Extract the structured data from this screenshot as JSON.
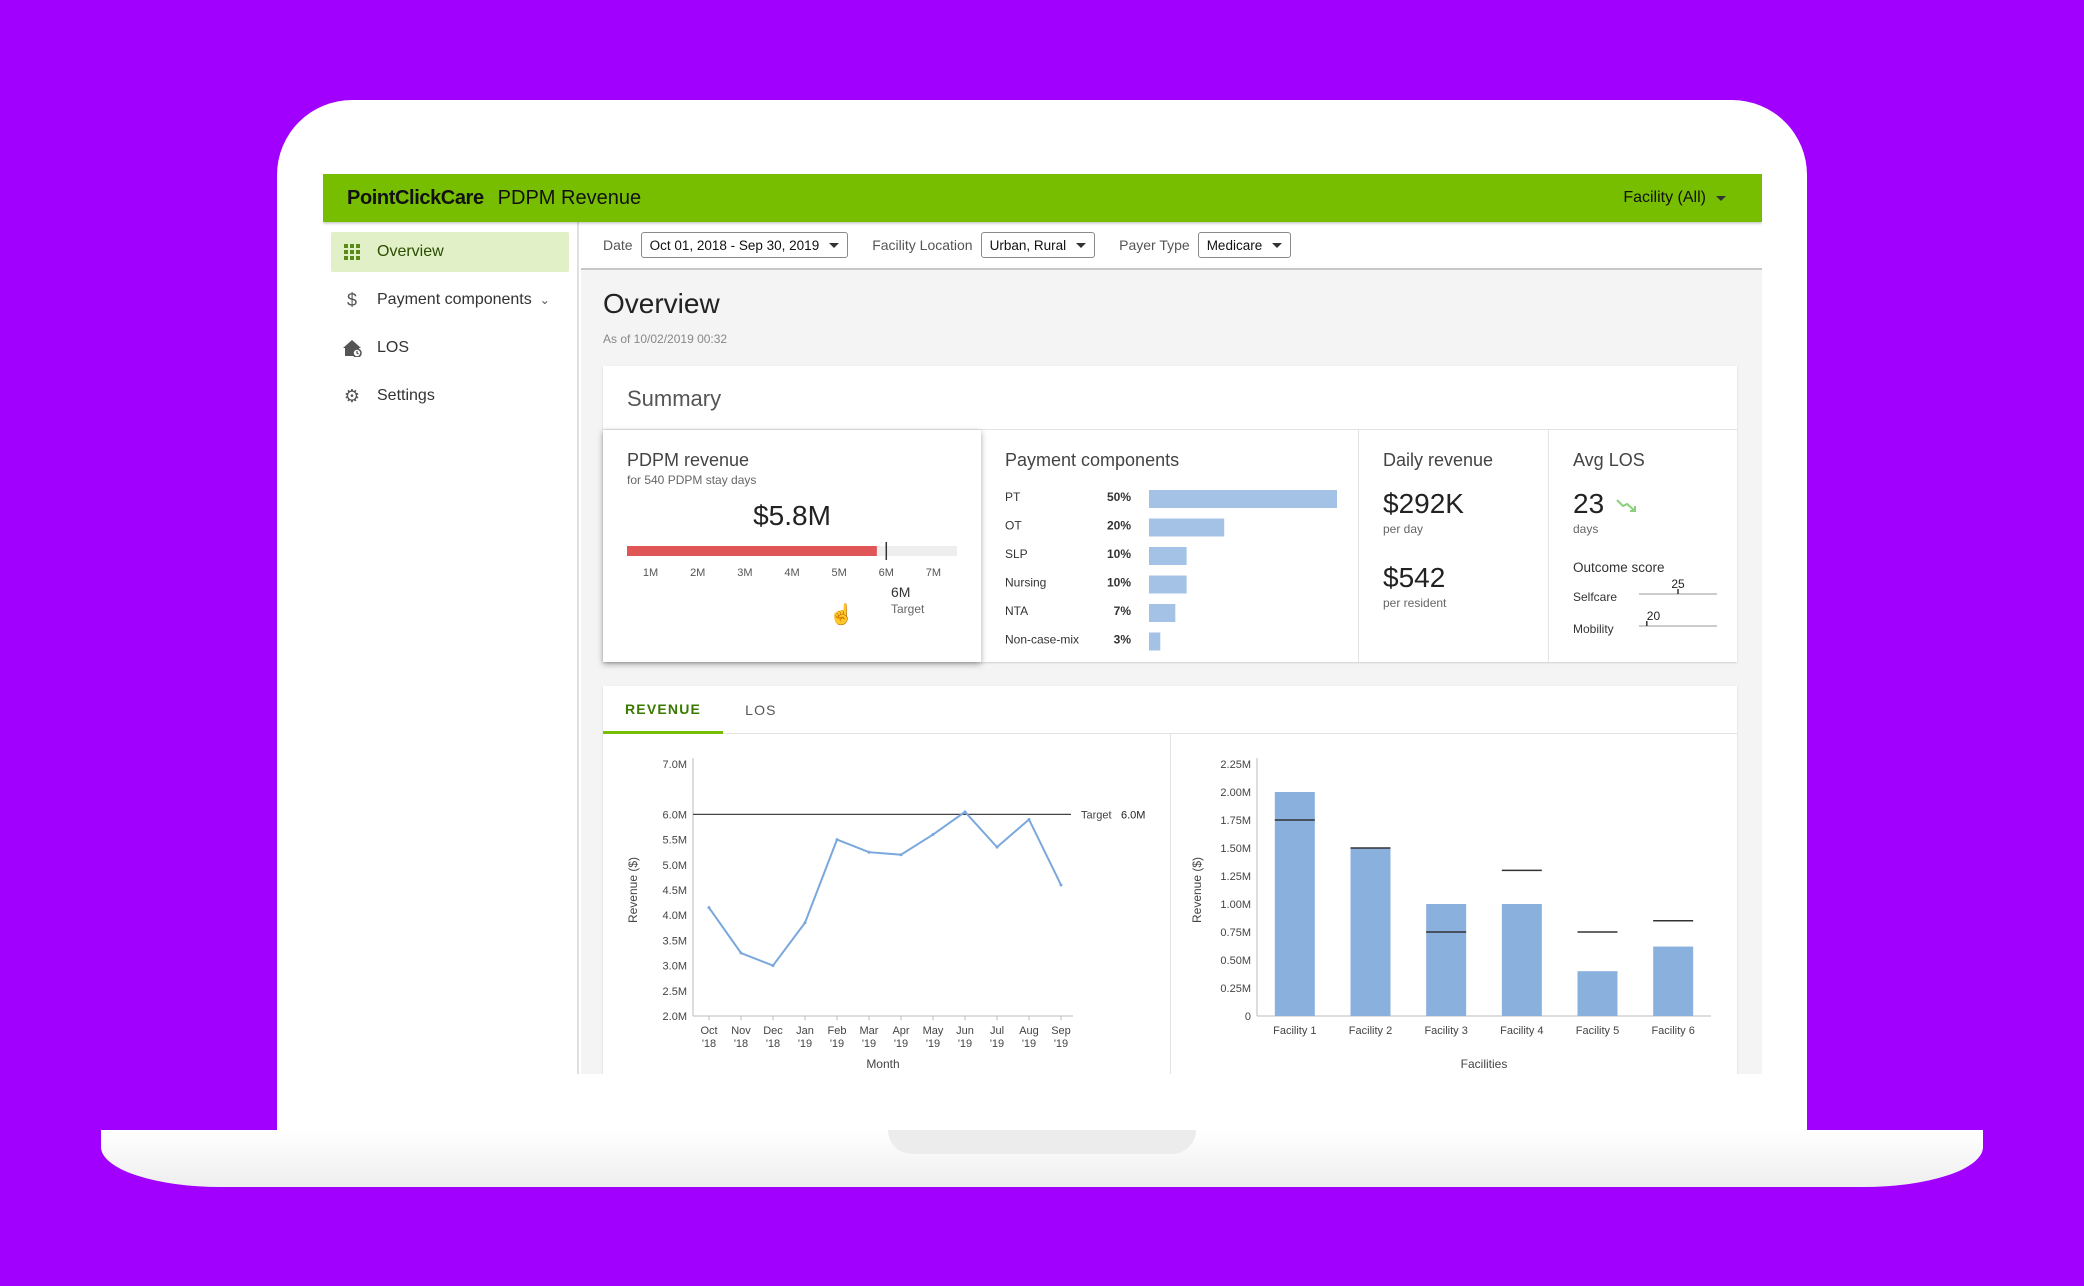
{
  "topbar": {
    "brand": "PointClickCare",
    "title": "PDPM Revenue",
    "facility": "Facility (All)"
  },
  "sidebar": {
    "items": [
      {
        "label": "Overview",
        "icon": "grid-icon",
        "active": true
      },
      {
        "label": "Payment components",
        "icon": "dollar-icon"
      },
      {
        "label": "LOS",
        "icon": "house-icon"
      },
      {
        "label": "Settings",
        "icon": "gear-icon"
      }
    ]
  },
  "filters": {
    "date_label": "Date",
    "date_value": "Oct 01, 2018 - Sep 30, 2019",
    "location_label": "Facility Location",
    "location_value": "Urban, Rural",
    "payer_label": "Payer Type",
    "payer_value": "Medicare"
  },
  "page": {
    "title": "Overview",
    "as_of": "As of 10/02/2019 00:32"
  },
  "summary": {
    "title": "Summary",
    "pdpm": {
      "title": "PDPM revenue",
      "subtitle": "for 540 PDPM stay days",
      "value": "$5.8M",
      "progress_value": 5.8,
      "scale_min": 0.5,
      "scale_max": 7.5,
      "target_value": 6,
      "ticks": [
        "1M",
        "2M",
        "3M",
        "4M",
        "5M",
        "6M",
        "7M"
      ],
      "target_label": "6M",
      "target_caption": "Target",
      "bar_color": "#e05555"
    },
    "payment": {
      "title": "Payment components",
      "rows": [
        {
          "label": "PT",
          "pct": "50%",
          "value": 50
        },
        {
          "label": "OT",
          "pct": "20%",
          "value": 20
        },
        {
          "label": "SLP",
          "pct": "10%",
          "value": 10
        },
        {
          "label": "Nursing",
          "pct": "10%",
          "value": 10
        },
        {
          "label": "NTA",
          "pct": "7%",
          "value": 7
        },
        {
          "label": "Non-case-mix",
          "pct": "3%",
          "value": 3
        }
      ],
      "bar_color": "#a4c2e6"
    },
    "daily": {
      "title": "Daily revenue",
      "value1": "$292K",
      "caption1": "per day",
      "value2": "$542",
      "caption2": "per resident"
    },
    "los": {
      "title": "Avg LOS",
      "value": "23",
      "caption": "days",
      "trend_icon": "trend-down-icon",
      "outcome_title": "Outcome score",
      "scores": [
        {
          "label": "Selfcare",
          "value": "25",
          "level": 0.5
        },
        {
          "label": "Mobility",
          "value": "20",
          "level": 0.1
        }
      ]
    }
  },
  "tabs": [
    {
      "label": "REVENUE",
      "active": true
    },
    {
      "label": "LOS",
      "active": false
    }
  ],
  "chart_data": [
    {
      "type": "line",
      "x": [
        [
          "Oct",
          "'18"
        ],
        [
          "Nov",
          "'18"
        ],
        [
          "Dec",
          "'18"
        ],
        [
          "Jan",
          "'19"
        ],
        [
          "Feb",
          "'19"
        ],
        [
          "Mar",
          "'19"
        ],
        [
          "Apr",
          "'19"
        ],
        [
          "May",
          "'19"
        ],
        [
          "Jun",
          "'19"
        ],
        [
          "Jul",
          "'19"
        ],
        [
          "Aug",
          "'19"
        ],
        [
          "Sep",
          "'19"
        ]
      ],
      "values": [
        4.15,
        3.25,
        3.0,
        3.85,
        5.5,
        5.25,
        5.2,
        5.6,
        6.05,
        5.35,
        5.9,
        4.6
      ],
      "yticks": [
        "2.0M",
        "2.5M",
        "3.0M",
        "3.5M",
        "4.0M",
        "4.5M",
        "5.0M",
        "5.5M",
        "6.0M",
        "7.0M"
      ],
      "ylim": [
        2.0,
        7.0
      ],
      "ylabel": "Revenue ($)",
      "xlabel": "Month",
      "target": {
        "value": 6.0,
        "label": "Target",
        "value_label": "6.0M"
      },
      "color": "#7aa8dc"
    },
    {
      "type": "bar",
      "categories": [
        "Facility 1",
        "Facility 2",
        "Facility 3",
        "Facility 4",
        "Facility 5",
        "Facility 6"
      ],
      "values": [
        2.0,
        1.5,
        1.0,
        1.0,
        0.4,
        0.62
      ],
      "targets": [
        1.75,
        1.5,
        0.75,
        1.3,
        0.75,
        0.85
      ],
      "yticks": [
        "0",
        "0.25M",
        "0.50M",
        "0.75M",
        "1.00M",
        "1.25M",
        "1.50M",
        "1.75M",
        "2.00M",
        "2.25M"
      ],
      "ylim": [
        0,
        2.25
      ],
      "ylabel": "Revenue ($)",
      "xlabel": "Facilities",
      "color": "#8ab0de"
    }
  ]
}
